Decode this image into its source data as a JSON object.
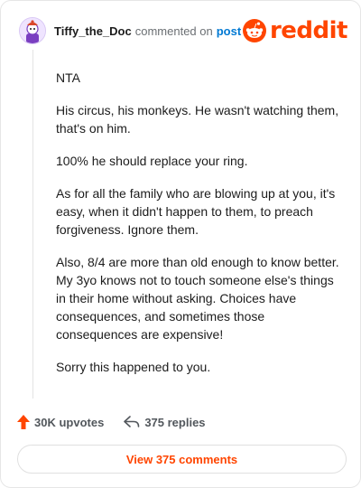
{
  "comment": {
    "username": "Tiffy_the_Doc",
    "action": "commented on",
    "target": "post",
    "paragraphs": [
      "NTA",
      "His circus, his monkeys. He wasn't watching them, that's on him.",
      "100% he should replace your ring.",
      "As for all the family who are blowing up at you, it's easy, when it didn't happen to them, to preach forgiveness. Ignore them.",
      "Also, 8/4 are more than old enough to know better. My 3yo knows not to touch someone else's things in their home without asking. Choices have consequences, and sometimes those consequences are expensive!",
      "Sorry this happened to you."
    ]
  },
  "brand": {
    "wordmark": "reddit",
    "color": "#ff4500",
    "icon": "reddit-snoo-icon"
  },
  "actions": {
    "upvotes": "30K upvotes",
    "replies": "375 replies",
    "upvote_icon": "upvote-arrow-icon",
    "reply_icon": "reply-arrow-icon"
  },
  "footer": {
    "view_comments_label": "View 375 comments"
  },
  "colors": {
    "accent": "#ff4500",
    "link": "#0079d3",
    "muted": "#6b6f73"
  }
}
